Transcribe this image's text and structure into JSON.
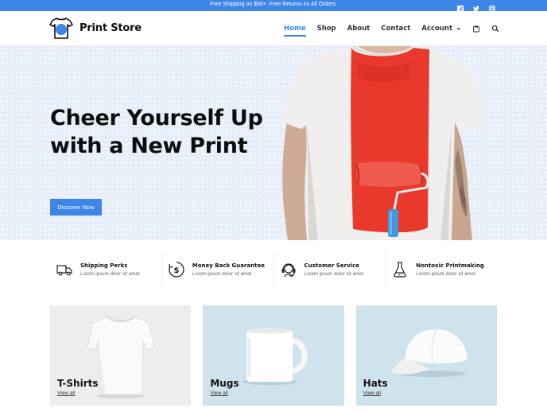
{
  "topbar": {
    "message": "Free Shipping on $50+. Free Returns on All Orders.",
    "social": [
      "facebook-icon",
      "twitter-icon",
      "instagram-icon"
    ]
  },
  "header": {
    "logo_text": "Print Store",
    "nav": [
      {
        "label": "Home",
        "active": true
      },
      {
        "label": "Shop"
      },
      {
        "label": "About"
      },
      {
        "label": "Contact"
      },
      {
        "label": "Account",
        "dropdown": true
      }
    ],
    "icons": [
      "shopping-bag-icon",
      "search-icon"
    ]
  },
  "hero": {
    "headline": "Cheer Yourself Up with a New Print",
    "button": "Discover Now"
  },
  "features": [
    {
      "title": "Shipping Perks",
      "subtitle": "Lorem ipsum dolor sit amet",
      "icon": "truck-icon"
    },
    {
      "title": "Money Back Guarantee",
      "subtitle": "Lorem ipsum dolor sit amet",
      "icon": "dollar-icon"
    },
    {
      "title": "Customer Service",
      "subtitle": "Lorem ipsum dolor sit amet",
      "icon": "headset-icon"
    },
    {
      "title": "Nontoxic Printmaking",
      "subtitle": "Lorem ipsum dolor sit amet",
      "icon": "flask-icon"
    }
  ],
  "categories": [
    {
      "title": "T-Shirts",
      "link": "View all",
      "bg": "#ededed"
    },
    {
      "title": "Mugs",
      "link": "View all",
      "bg": "#cfe3ec"
    },
    {
      "title": "Hats",
      "link": "View all",
      "bg": "#cfe3ec"
    }
  ],
  "colors": {
    "accent": "#3d86e8",
    "hero_bg": "#e7eef9",
    "shirt_red": "#e8392c"
  }
}
